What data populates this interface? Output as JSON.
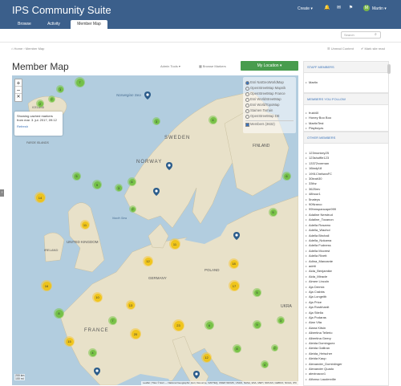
{
  "header": {
    "site_title": "IPS Community Suite",
    "create_label": "Create",
    "user_name": "Martin",
    "user_initial": "M",
    "tabs": [
      "Browse",
      "Activity",
      "Member Map"
    ]
  },
  "search": {
    "placeholder": "Search"
  },
  "breadcrumb": {
    "home": "Home",
    "current": "Member Map"
  },
  "top_links": {
    "unread": "Unread Content",
    "mark_read": "Mark site read"
  },
  "page": {
    "title": "Member Map",
    "admin_tools": "Admin Tools",
    "browse_markers": "Browse Markers",
    "my_location": "My Location"
  },
  "popup": {
    "line1": "Showing cached markers",
    "line2": "from mar. 3. jul. 2017, 09:12",
    "link": "Refresh"
  },
  "layers": {
    "options": [
      "Esri NatGeoWorldMap",
      "OpenStreetMap Mapnik",
      "OpenStreetMap France",
      "Esri WorldStreetMap",
      "Esri WorldTopoMap",
      "Stamen Terrain",
      "OpenStreetMap DE"
    ],
    "selected": 0,
    "overlays": [
      "Members (3632)"
    ]
  },
  "map": {
    "scale_km": "200 km",
    "scale_mi": "100 mi",
    "attribution": "Leaflet | Tiles © Esri — National Geographic, Esri, DeLorme, NAVTEQ, UNEP-WCMC, USGS, NASA, ESA, METI, NRCAN, GEBCO, NOAA, iPC",
    "clusters": [
      {
        "n": "7",
        "c": "g"
      },
      {
        "n": "3",
        "c": "g"
      },
      {
        "n": "2",
        "c": "g"
      },
      {
        "n": "2",
        "c": "g"
      },
      {
        "n": "4",
        "c": "g"
      },
      {
        "n": "3",
        "c": "g"
      },
      {
        "n": "5",
        "c": "g"
      },
      {
        "n": "9",
        "c": "g"
      },
      {
        "n": "14",
        "c": "y"
      },
      {
        "n": "6",
        "c": "g"
      },
      {
        "n": "3",
        "c": "g"
      },
      {
        "n": "2",
        "c": "g"
      },
      {
        "n": "16",
        "c": "y"
      },
      {
        "n": "11",
        "c": "y"
      },
      {
        "n": "18",
        "c": "y"
      },
      {
        "n": "12",
        "c": "y"
      },
      {
        "n": "17",
        "c": "y"
      },
      {
        "n": "10",
        "c": "y"
      },
      {
        "n": "8",
        "c": "g"
      },
      {
        "n": "23",
        "c": "y"
      },
      {
        "n": "13",
        "c": "y"
      },
      {
        "n": "20",
        "c": "y"
      },
      {
        "n": "6",
        "c": "g"
      },
      {
        "n": "5",
        "c": "g"
      },
      {
        "n": "9",
        "c": "g"
      },
      {
        "n": "2",
        "c": "g"
      },
      {
        "n": "15",
        "c": "y"
      },
      {
        "n": "4",
        "c": "g"
      },
      {
        "n": "7",
        "c": "g"
      },
      {
        "n": "3",
        "c": "g"
      },
      {
        "n": "12",
        "c": "y"
      },
      {
        "n": "6",
        "c": "g"
      },
      {
        "n": "5",
        "c": "g"
      },
      {
        "n": "8",
        "c": "g"
      },
      {
        "n": "11",
        "c": "y"
      },
      {
        "n": "4",
        "c": "g"
      }
    ],
    "labels": [
      "SWEDEN",
      "NORWAY",
      "FINLAND",
      "UNITED KINGDOM",
      "IRELAND",
      "FRANCE",
      "GERMANY",
      "POLAND",
      "Norwegian Sea",
      "North Sea",
      "FAROE ISLANDS",
      "ICELAND",
      "UKRA"
    ]
  },
  "sidebar": {
    "staff_header": "STAFF MEMBERS",
    "staff": [
      "Martin"
    ],
    "follow_header": "MEMBERS YOU FOLLOW",
    "follow": [
      "frukt40",
      "Honey Boo Boo",
      "MartinTest",
      "Playboyzs"
    ],
    "other_header": "OTHER MEMBERS",
    "other": [
      "123monkey25",
      "123shuffle123",
      "13372vxeman",
      "16lady18",
      "1991ChelseaFC",
      "30leah30",
      "33thz",
      "3625mv",
      "48hour1",
      "5nateys",
      "90Nrarco",
      "99hmspancape999",
      "Adaline Nerstrud",
      "Adaline_Tocanon",
      "Adella Rosamo",
      "Adella_Wachol",
      "Adella Birchall",
      "Adella_Nokama",
      "Adella Fudness",
      "Adella Mccrest",
      "Adella Rivett",
      "Adina_Manzante",
      "adriti",
      "Aida_Benjamike",
      "Aida_Miracle",
      "Aimee Lincoln",
      "Aja Derrick",
      "Aja Crabbs",
      "Aja Longeith",
      "Aja Price",
      "Aja Rosbhardt",
      "Aja Stiella",
      "Aja Podaras",
      "Alan Vita",
      "Alana Kitsin",
      "Albertina Tellerio",
      "Albertina Geery",
      "Aleida Dominguez",
      "Aleida Galliran",
      "Aleida_Heischer",
      "Aleida Kaup",
      "Alexander_Dominiinger",
      "Alexander Quado",
      "alexinacov1",
      "Alfonso Lauderville"
    ]
  },
  "colors": {
    "header": "#3b5f8b",
    "accent": "#3b73b9",
    "green_button": "#489c4d",
    "cluster_green": "#6ebe3c",
    "cluster_yellow": "#f0c20c",
    "sea": "#b2cddf",
    "land": "#e8e1c9"
  }
}
